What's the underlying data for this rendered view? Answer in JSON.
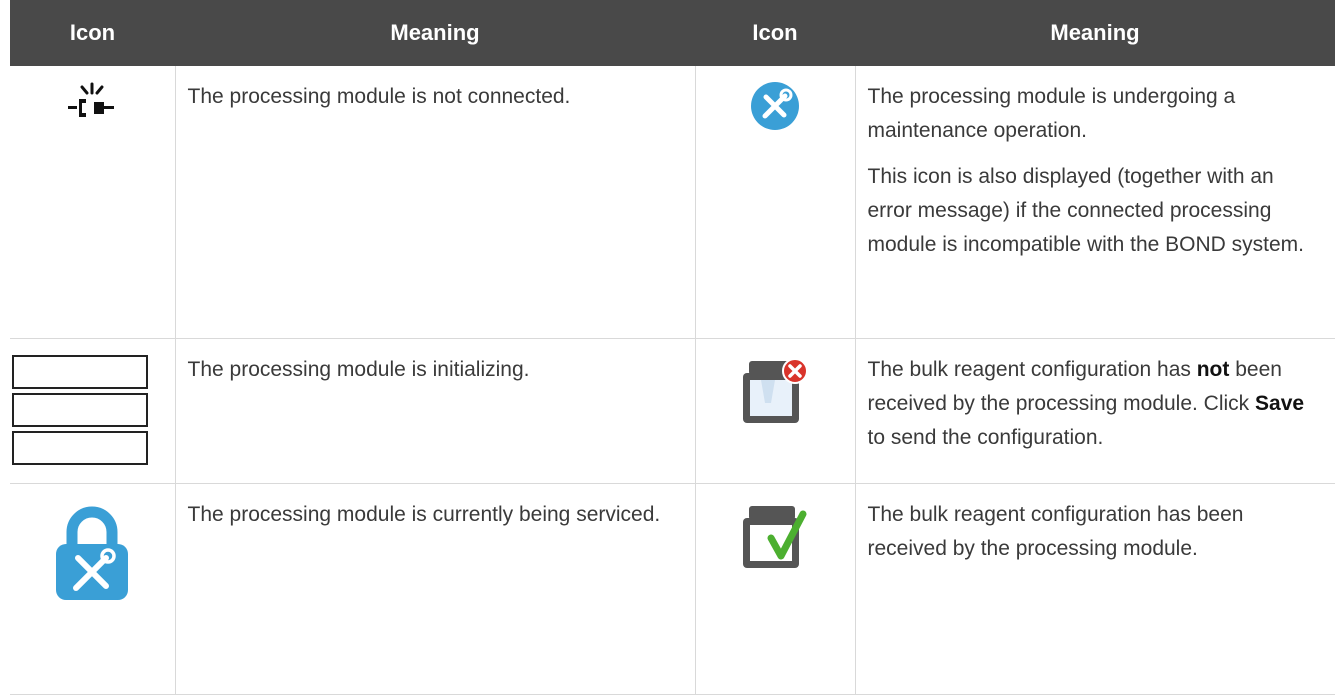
{
  "header": {
    "icon1": "Icon",
    "meaning1": "Meaning",
    "icon2": "Icon",
    "meaning2": "Meaning"
  },
  "rows": [
    {
      "left": {
        "icon": "not-connected-plug-icon",
        "text": "The processing module is not connected."
      },
      "right": {
        "icon": "maintenance-wrench-icon",
        "text1": "The processing module is undergoing a maintenance operation.",
        "text2": "This icon is also displayed (together with an error message) if the connected processing module is incompatible with the BOND system."
      }
    },
    {
      "left": {
        "icon": "initializing-boxes-icon",
        "text": "The processing module is initializing."
      },
      "right": {
        "icon": "bulk-reagent-not-received-icon",
        "text_a": "The bulk reagent configuration has ",
        "text_b": "not",
        "text_c": " been received by the processing module. Click ",
        "text_d": "Save",
        "text_e": " to send the configuration."
      }
    },
    {
      "left": {
        "icon": "service-lock-icon",
        "text": "The processing module is currently being serviced."
      },
      "right": {
        "icon": "bulk-reagent-received-icon",
        "text": "The bulk reagent configuration has been received by the processing module."
      }
    }
  ],
  "colors": {
    "header_bg": "#494949",
    "icon_blue": "#3a9fd6",
    "error_red": "#d9342b",
    "check_green": "#4caf30"
  }
}
